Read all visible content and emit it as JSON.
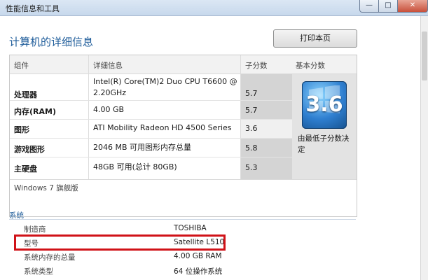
{
  "window": {
    "title": "性能信息和工具",
    "controls": {
      "minimize": "—",
      "maximize": "□",
      "close": "✕"
    }
  },
  "page": {
    "title": "计算机的详细信息",
    "print_button": "打印本页"
  },
  "table": {
    "headers": {
      "component": "组件",
      "details": "详细信息",
      "subscore": "子分数",
      "base": "基本分数"
    },
    "rows": [
      {
        "label": "处理器",
        "detail_line1": "Intel(R) Core(TM)2 Duo CPU T6600 @",
        "detail_line2": "2.20GHz",
        "score": "5.7"
      },
      {
        "label": "内存(RAM)",
        "detail_line1": "4.00 GB",
        "detail_line2": "",
        "score": "5.7"
      },
      {
        "label": "图形",
        "detail_line1": "ATI Mobility Radeon HD 4500 Series",
        "detail_line2": "",
        "score": "3.6"
      },
      {
        "label": "游戏图形",
        "detail_line1": "2046 MB 可用图形内存总量",
        "detail_line2": "",
        "score": "5.8"
      },
      {
        "label": "主硬盘",
        "detail_line1": "48GB 可用(总计 80GB)",
        "detail_line2": "",
        "score": "5.3"
      }
    ],
    "base_score": "3.6",
    "base_note": "由最低子分数决定",
    "edition": "Windows 7 旗舰版"
  },
  "system": {
    "header": "系统",
    "rows": [
      {
        "key": "制造商",
        "value": "TOSHIBA"
      },
      {
        "key": "型号",
        "value": "Satellite L510"
      },
      {
        "key": "系统内存的总量",
        "value": "4.00 GB RAM"
      },
      {
        "key": "系统类型",
        "value": "64 位操作系统"
      }
    ]
  },
  "colors": {
    "accent": "#1e5c9a",
    "highlight": "#d01218"
  },
  "icons": {
    "badge": "windows-experience-index-badge"
  }
}
